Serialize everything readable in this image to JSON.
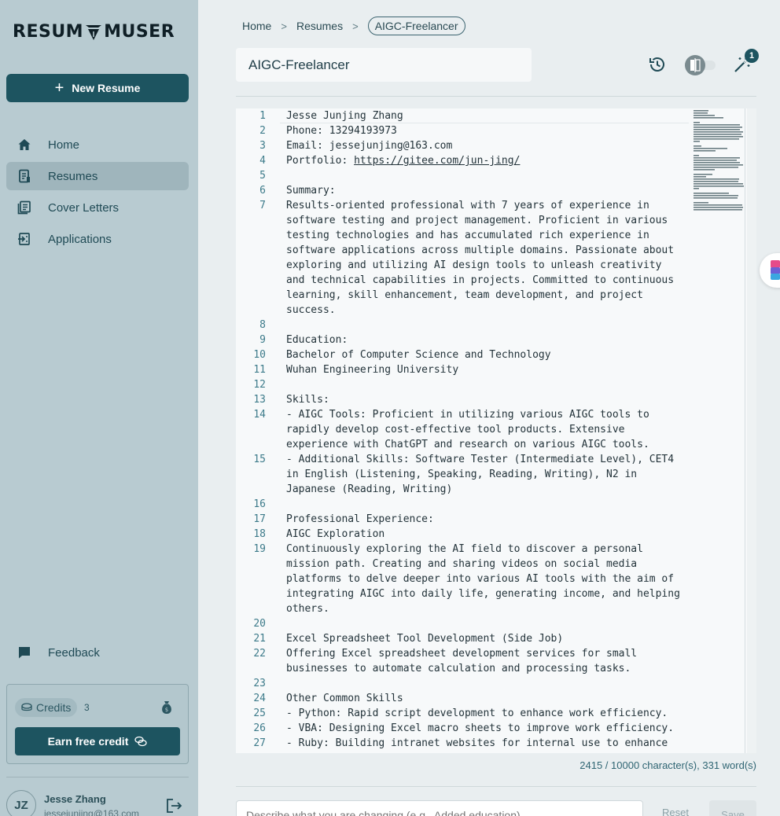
{
  "app": {
    "logo_text_left": "RESUM",
    "logo_text_right": "MUSER"
  },
  "sidebar": {
    "new_resume_label": "New Resume",
    "items": [
      {
        "label": "Home",
        "icon": "home-icon",
        "active": false
      },
      {
        "label": "Resumes",
        "icon": "resume-icon",
        "active": true
      },
      {
        "label": "Cover Letters",
        "icon": "cover-letter-icon",
        "active": false
      },
      {
        "label": "Applications",
        "icon": "applications-icon",
        "active": false
      }
    ],
    "feedback_label": "Feedback",
    "credits": {
      "label": "Credits",
      "count": "3",
      "earn_label": "Earn free credit"
    },
    "user": {
      "initials": "JZ",
      "name": "Jesse Zhang",
      "email": "jessejunjing@163.com"
    }
  },
  "breadcrumb": {
    "home": "Home",
    "resumes": "Resumes",
    "current": "AIGC-Freelancer"
  },
  "editor": {
    "title_value": "AIGC-Freelancer",
    "notification_count": "1",
    "lines": [
      {
        "n": "1",
        "text": "Jesse Junjing Zhang"
      },
      {
        "n": "2",
        "text": "Phone: 13294193973"
      },
      {
        "n": "3",
        "text": "Email: jessejunjing@163.com"
      },
      {
        "n": "4",
        "text": "Portfolio: ",
        "link": "https://gitee.com/jun-jing/"
      },
      {
        "n": "5",
        "text": ""
      },
      {
        "n": "6",
        "text": "Summary:"
      },
      {
        "n": "7",
        "text": "Results-oriented professional with 7 years of experience in"
      },
      {
        "n": "",
        "text": "software testing and project management. Proficient in various"
      },
      {
        "n": "",
        "text": "testing technologies and has accumulated rich experience in"
      },
      {
        "n": "",
        "text": "software applications across multiple domains. Passionate about"
      },
      {
        "n": "",
        "text": "exploring and utilizing AI design tools to unleash creativity"
      },
      {
        "n": "",
        "text": "and technical capabilities in projects. Committed to continuous"
      },
      {
        "n": "",
        "text": "learning, skill enhancement, team development, and project"
      },
      {
        "n": "",
        "text": "success."
      },
      {
        "n": "8",
        "text": ""
      },
      {
        "n": "9",
        "text": "Education:"
      },
      {
        "n": "10",
        "text": "Bachelor of Computer Science and Technology"
      },
      {
        "n": "11",
        "text": "Wuhan Engineering University"
      },
      {
        "n": "12",
        "text": ""
      },
      {
        "n": "13",
        "text": "Skills:"
      },
      {
        "n": "14",
        "text": "- AIGC Tools: Proficient in utilizing various AIGC tools to"
      },
      {
        "n": "",
        "text": "rapidly develop cost-effective tool products. Extensive"
      },
      {
        "n": "",
        "text": "experience with ChatGPT and research on various AIGC tools."
      },
      {
        "n": "15",
        "text": "- Additional Skills: Software Tester (Intermediate Level), CET4"
      },
      {
        "n": "",
        "text": "in English (Listening, Speaking, Reading, Writing), N2 in"
      },
      {
        "n": "",
        "text": "Japanese (Reading, Writing)"
      },
      {
        "n": "16",
        "text": ""
      },
      {
        "n": "17",
        "text": "Professional Experience:"
      },
      {
        "n": "18",
        "text": "AIGC Exploration"
      },
      {
        "n": "19",
        "text": "Continuously exploring the AI field to discover a personal"
      },
      {
        "n": "",
        "text": "mission path. Creating and sharing videos on social media"
      },
      {
        "n": "",
        "text": "platforms to delve deeper into various AI tools with the aim of"
      },
      {
        "n": "",
        "text": "integrating AIGC into daily life, generating income, and helping"
      },
      {
        "n": "",
        "text": "others."
      },
      {
        "n": "20",
        "text": ""
      },
      {
        "n": "21",
        "text": "Excel Spreadsheet Tool Development (Side Job)"
      },
      {
        "n": "22",
        "text": "Offering Excel spreadsheet development services for small"
      },
      {
        "n": "",
        "text": "businesses to automate calculation and processing tasks."
      },
      {
        "n": "23",
        "text": ""
      },
      {
        "n": "24",
        "text": "Other Common Skills"
      },
      {
        "n": "25",
        "text": "- Python: Rapid script development to enhance work efficiency."
      },
      {
        "n": "26",
        "text": "- VBA: Designing Excel macro sheets to improve work efficiency."
      },
      {
        "n": "27",
        "text": "- Ruby: Building intranet websites for internal use to enhance"
      }
    ],
    "counter_text": "2415 / 10000 character(s),  331 word(s)",
    "description_placeholder": "Describe what you are changing (e.g., Added education)",
    "reset_label": "Reset",
    "save_label": "Save"
  },
  "colors": {
    "primary": "#1d5460",
    "sidebar_bg": "#b8cbd1",
    "active_item": "#9fb5bc",
    "line_number": "#3d7b8a"
  }
}
